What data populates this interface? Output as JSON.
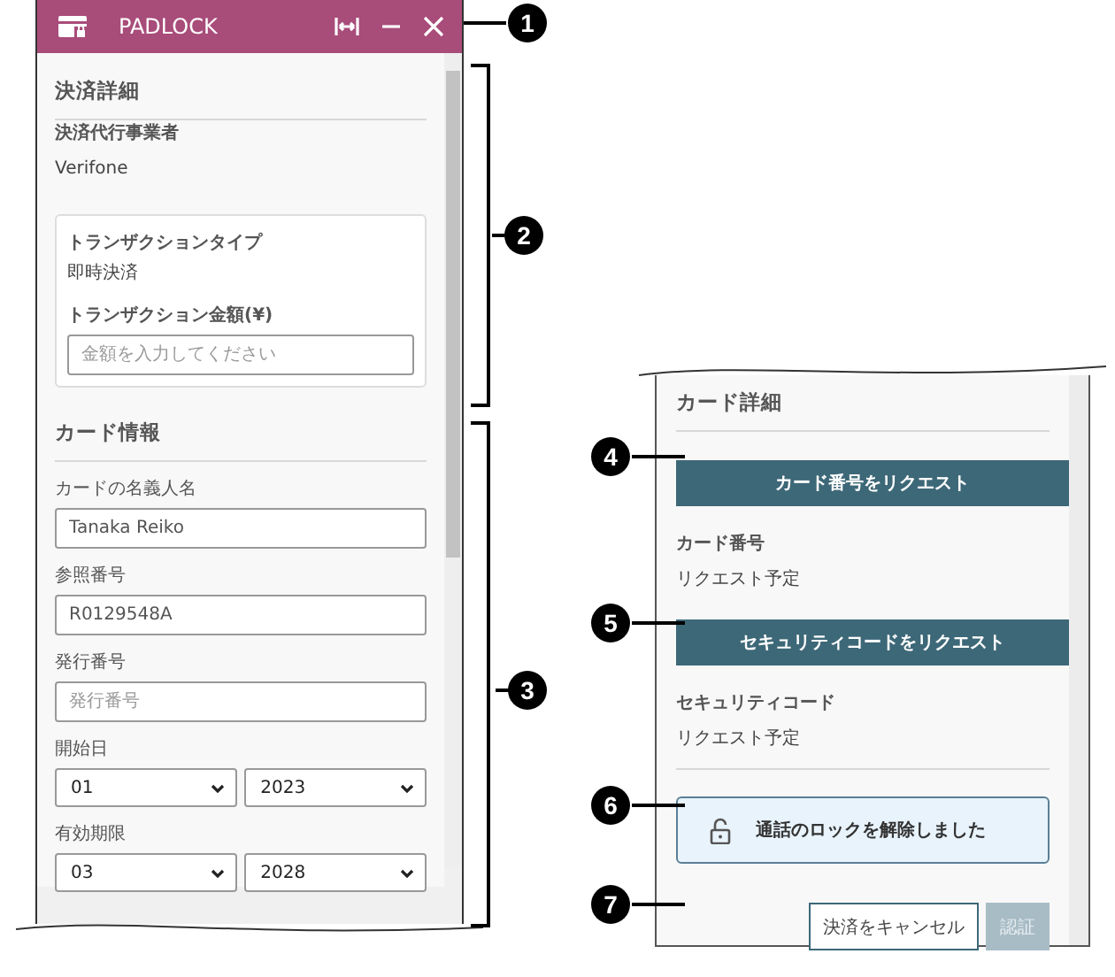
{
  "window": {
    "title": "PADLOCK"
  },
  "payment_details": {
    "heading": "決済詳細",
    "provider_label": "決済代行事業者",
    "provider": "Verifone",
    "transaction": {
      "type_label": "トランザクションタイプ",
      "type": "即時決済",
      "amount_label": "トランザクション金額(¥)",
      "amount_field": {
        "placeholder": "金額を入力してください"
      }
    }
  },
  "card_info": {
    "heading": "カード情報",
    "fields": [
      {
        "kind": "text",
        "label": "カードの名義人名",
        "value": "Tanaka Reiko"
      },
      {
        "kind": "text",
        "label": "参照番号",
        "value": "R0129548A"
      },
      {
        "kind": "text",
        "label": "発行番号",
        "placeholder": "発行番号"
      },
      {
        "kind": "date",
        "label": "開始日",
        "month": "01",
        "year": "2023"
      },
      {
        "kind": "date",
        "label": "有効期限",
        "month": "03",
        "year": "2028"
      }
    ]
  },
  "card_details": {
    "heading": "カード詳細",
    "items": [
      {
        "button": "カード番号をリクエスト",
        "label": "カード番号",
        "value": "リクエスト予定"
      },
      {
        "button": "セキュリティコードをリクエスト",
        "label": "セキュリティコード",
        "value": "リクエスト予定"
      }
    ],
    "status": "通話のロックを解除しました",
    "buttons": [
      {
        "label": "決済をキャンセル",
        "disabled": false
      },
      {
        "label": "認証",
        "disabled": true
      }
    ]
  },
  "callouts": [
    "1",
    "2",
    "3",
    "4",
    "5",
    "6",
    "7"
  ]
}
